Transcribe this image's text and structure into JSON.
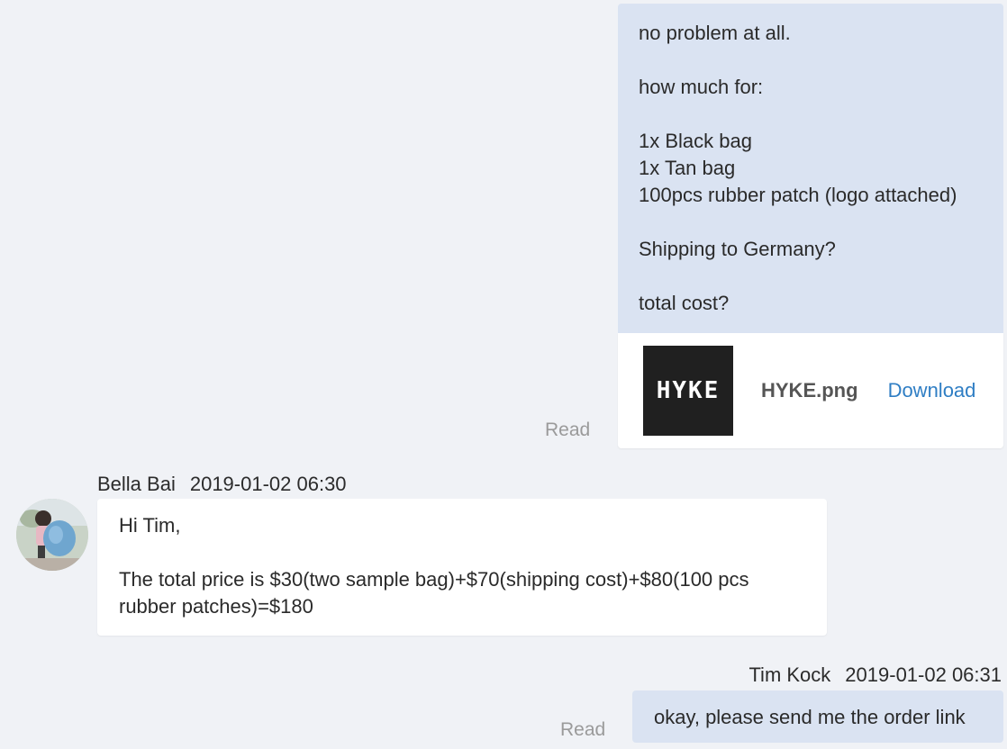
{
  "messages": {
    "outgoing_1": {
      "text": "no problem at all.\n\nhow much for:\n\n1x Black bag\n1x Tan bag\n100pcs rubber patch (logo attached)\n\nShipping to Germany?\n\ntotal cost?",
      "attachment": {
        "thumbnail_text": "HYKE",
        "file_name": "HYKE.png",
        "download_label": "Download"
      },
      "status": "Read"
    },
    "incoming_1": {
      "sender": "Bella Bai",
      "timestamp": "2019-01-02 06:30",
      "text": "Hi Tim,\n\nThe total price is $30(two sample bag)+$70(shipping cost)+$80(100 pcs rubber patches)=$180"
    },
    "outgoing_2": {
      "sender": "Tim Kock",
      "timestamp": "2019-01-02 06:31",
      "text": "okay, please send me the order link",
      "status": "Read"
    }
  },
  "colors": {
    "background": "#f0f2f6",
    "outgoing_bubble": "#dae3f2",
    "incoming_bubble": "#ffffff",
    "link": "#2f7ec4",
    "status_text": "#9a9a9a"
  },
  "icons": {
    "avatar": "user-avatar-photo"
  }
}
